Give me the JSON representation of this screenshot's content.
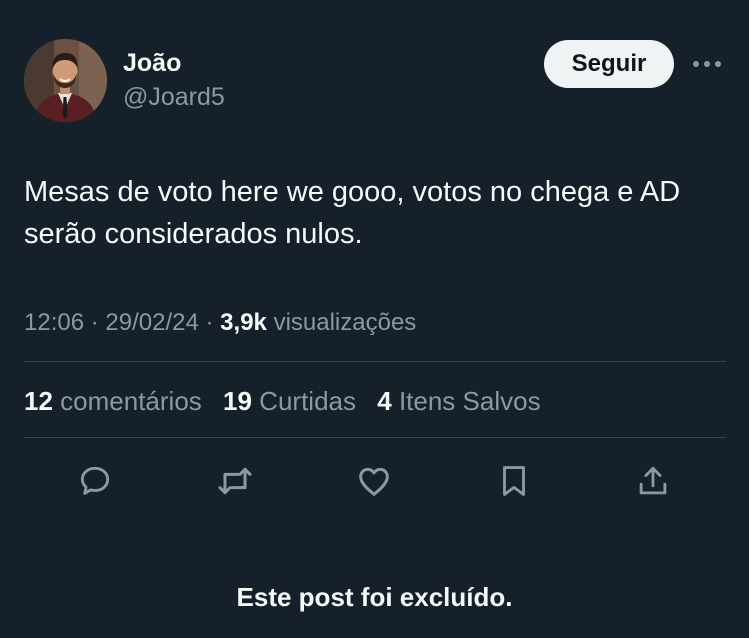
{
  "author": {
    "display_name": "João",
    "handle": "@Joard5"
  },
  "follow_label": "Seguir",
  "post": {
    "text": "Mesas de voto here we gooo, votos no chega e AD serão considerados nulos.",
    "time": "12:06",
    "date": "29/02/24",
    "separator": "·",
    "views_count": "3,9k",
    "views_label": "visualizações"
  },
  "stats": {
    "comments_count": "12",
    "comments_label": "comentários",
    "likes_count": "19",
    "likes_label": "Curtidas",
    "bookmarks_count": "4",
    "bookmarks_label": "Itens Salvos"
  },
  "actions": [
    "reply-icon",
    "retweet-icon",
    "like-icon",
    "bookmark-icon",
    "share-icon"
  ],
  "deleted_notice": "Este post foi excluído.",
  "colors": {
    "background": "#15202b",
    "primary_text": "#f7f9f9",
    "secondary_text": "#8b98a5",
    "divider": "#38444d",
    "follow_button_bg": "#eff3f4",
    "follow_button_text": "#0f1419"
  }
}
